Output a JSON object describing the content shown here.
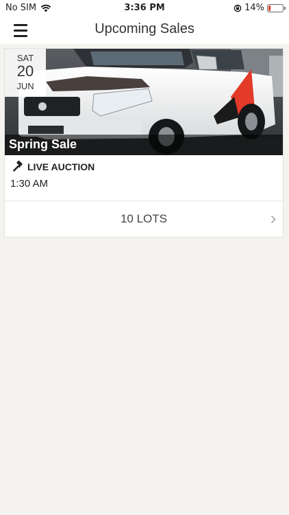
{
  "status_bar": {
    "carrier": "No SIM",
    "time": "3:36 PM",
    "battery_percent": "14%",
    "battery_level": 0.14,
    "battery_color": "#e03a2f"
  },
  "nav": {
    "title": "Upcoming Sales",
    "menu_icon": "hamburger-menu-icon"
  },
  "sale": {
    "date": {
      "day_of_week": "SAT",
      "day": "20",
      "month": "JUN"
    },
    "image_icon": "white-pickup-truck-photo",
    "name": "Spring Sale",
    "type_icon": "gavel-icon",
    "type": "LIVE AUCTION",
    "time": "1:30 AM",
    "lots_label": "10 LOTS",
    "lots_icon": "chevron-right-icon"
  },
  "colors": {
    "background": "#f4f3ef",
    "card": "#ffffff",
    "name_overlay": "rgba(0,0,0,0.55)"
  }
}
